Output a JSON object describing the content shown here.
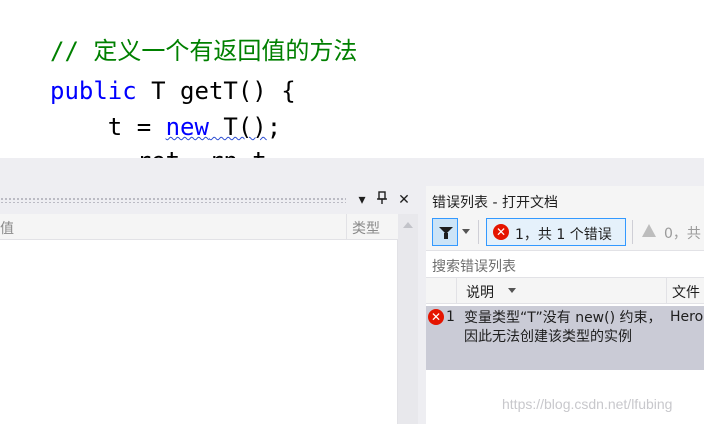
{
  "editor": {
    "comment": "// 定义一个有返回值的方法",
    "line2_kw": "public",
    "line2_rest": " T getT() {",
    "line3_pre": "    t = ",
    "line3_kw": "new",
    "line3_squig": " T()",
    "line3_post": ";",
    "line4": "      ret  rn t"
  },
  "watch": {
    "col_value": "值",
    "col_type": "类型",
    "buttons": {
      "dropdown": "▾",
      "pin": "📌",
      "close": "✕"
    }
  },
  "error_list": {
    "title": "错误列表 - 打开文档",
    "errors_filter_label": "1，共 1 个错误",
    "error_icon": "✕",
    "warnings_label": "0，共",
    "search_placeholder": "搜索错误列表",
    "columns": {
      "description": "说明",
      "file": "文件"
    },
    "rows": [
      {
        "number": "1",
        "description": "变量类型“T”没有 new() 约束，因此无法创建该类型的实例",
        "file": "Hero"
      }
    ]
  },
  "watermark": "https://blog.csdn.net/lfubing"
}
